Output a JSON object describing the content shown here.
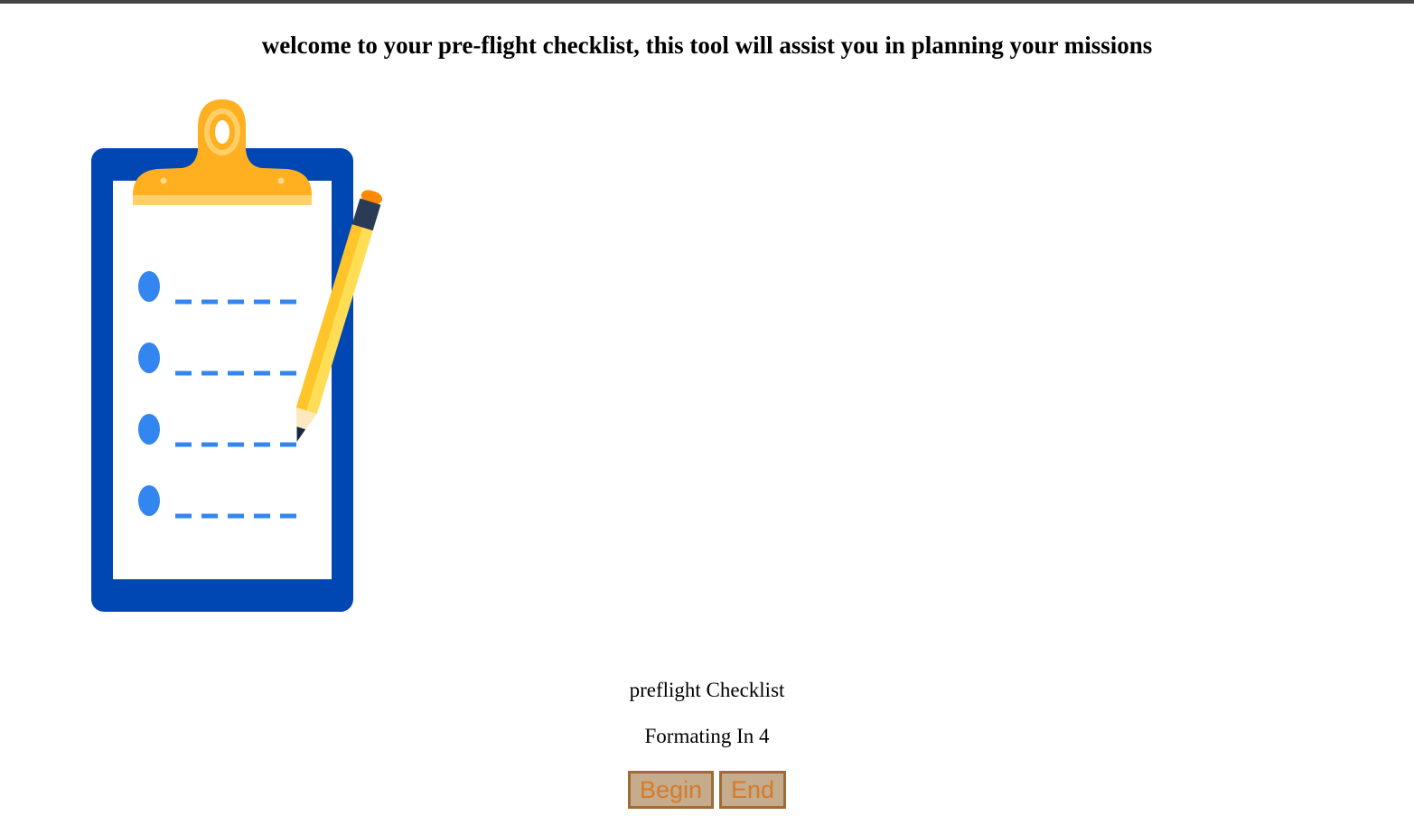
{
  "header": {
    "welcome_text": "welcome to your pre-flight checklist, this tool will assist you in planning your missions"
  },
  "illustration": {
    "icon": "clipboard-checklist-icon",
    "colors": {
      "board": "#0047b3",
      "paper": "#ffffff",
      "clip": "#ffb020",
      "bullets": "#3385f0",
      "pencil_body": "#ffc52a",
      "pencil_band": "#2b3a55",
      "pencil_eraser": "#ff8a00"
    }
  },
  "main": {
    "title": "preflight Checklist",
    "status": "Formating In 4"
  },
  "actions": {
    "begin_label": "Begin",
    "end_label": "End"
  }
}
